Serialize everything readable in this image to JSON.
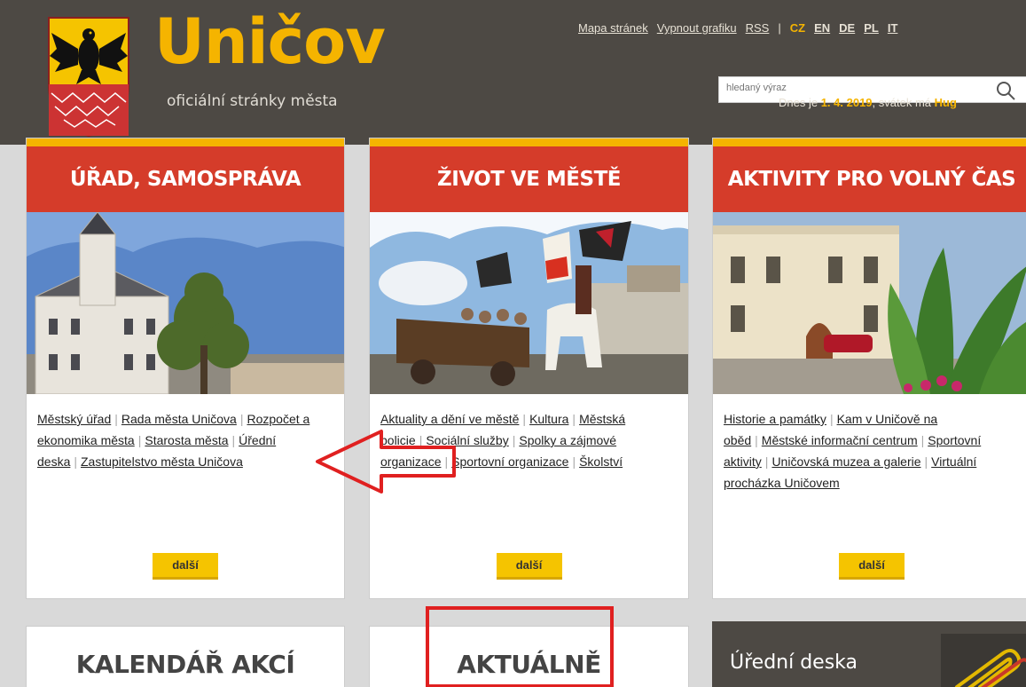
{
  "header": {
    "brand_name": "Uničov",
    "brand_sub": "oficiální stránky města",
    "links": [
      "Mapa stránek",
      "Vypnout grafiku",
      "RSS"
    ],
    "separator": "|",
    "lang_active": "CZ",
    "langs": [
      "EN",
      "DE",
      "PL",
      "IT"
    ],
    "search_placeholder": "hledaný výraz",
    "today_prefix": "Dnes je",
    "today_date": "1. 4. 2019",
    "today_mid": ", svátek má",
    "today_name": "Hug"
  },
  "cards": [
    {
      "title": "ÚŘAD, SAMOSPRÁVA",
      "links": [
        "Městský úřad",
        "Rada města Uničova",
        "Rozpočet a ekonomika města",
        "Starosta města",
        "Úřední deska",
        "Zastupitelstvo města Uničova"
      ],
      "more": "další"
    },
    {
      "title": "ŽIVOT VE MĚSTĚ",
      "links": [
        "Aktuality a dění ve městě",
        "Kultura",
        "Městská policie",
        "Sociální služby",
        "Spolky a zájmové organizace",
        "Sportovní organizace",
        "Školství"
      ],
      "more": "další"
    },
    {
      "title": "AKTIVITY PRO VOLNÝ ČAS",
      "links": [
        "Historie a památky",
        "Kam v Uničově na oběd",
        "Městské informační centrum",
        "Sportovní aktivity",
        "Uničovská muzea a galerie",
        "Virtuální procházka Uničovem"
      ],
      "more": "další"
    }
  ],
  "bottom": {
    "calendar": "KALENDÁŘ AKCÍ",
    "news": "AKTUÁLNĚ",
    "board": "Úřední deska"
  },
  "colors": {
    "header_bg": "#4d4944",
    "brand": "#f5b400",
    "card_head": "#d53c2a",
    "button": "#f5c400",
    "annotation": "#e02020"
  },
  "icons": {
    "crest": "coat-of-arms-eagle-icon",
    "search": "search-icon",
    "paperclip": "paperclip-icon"
  }
}
